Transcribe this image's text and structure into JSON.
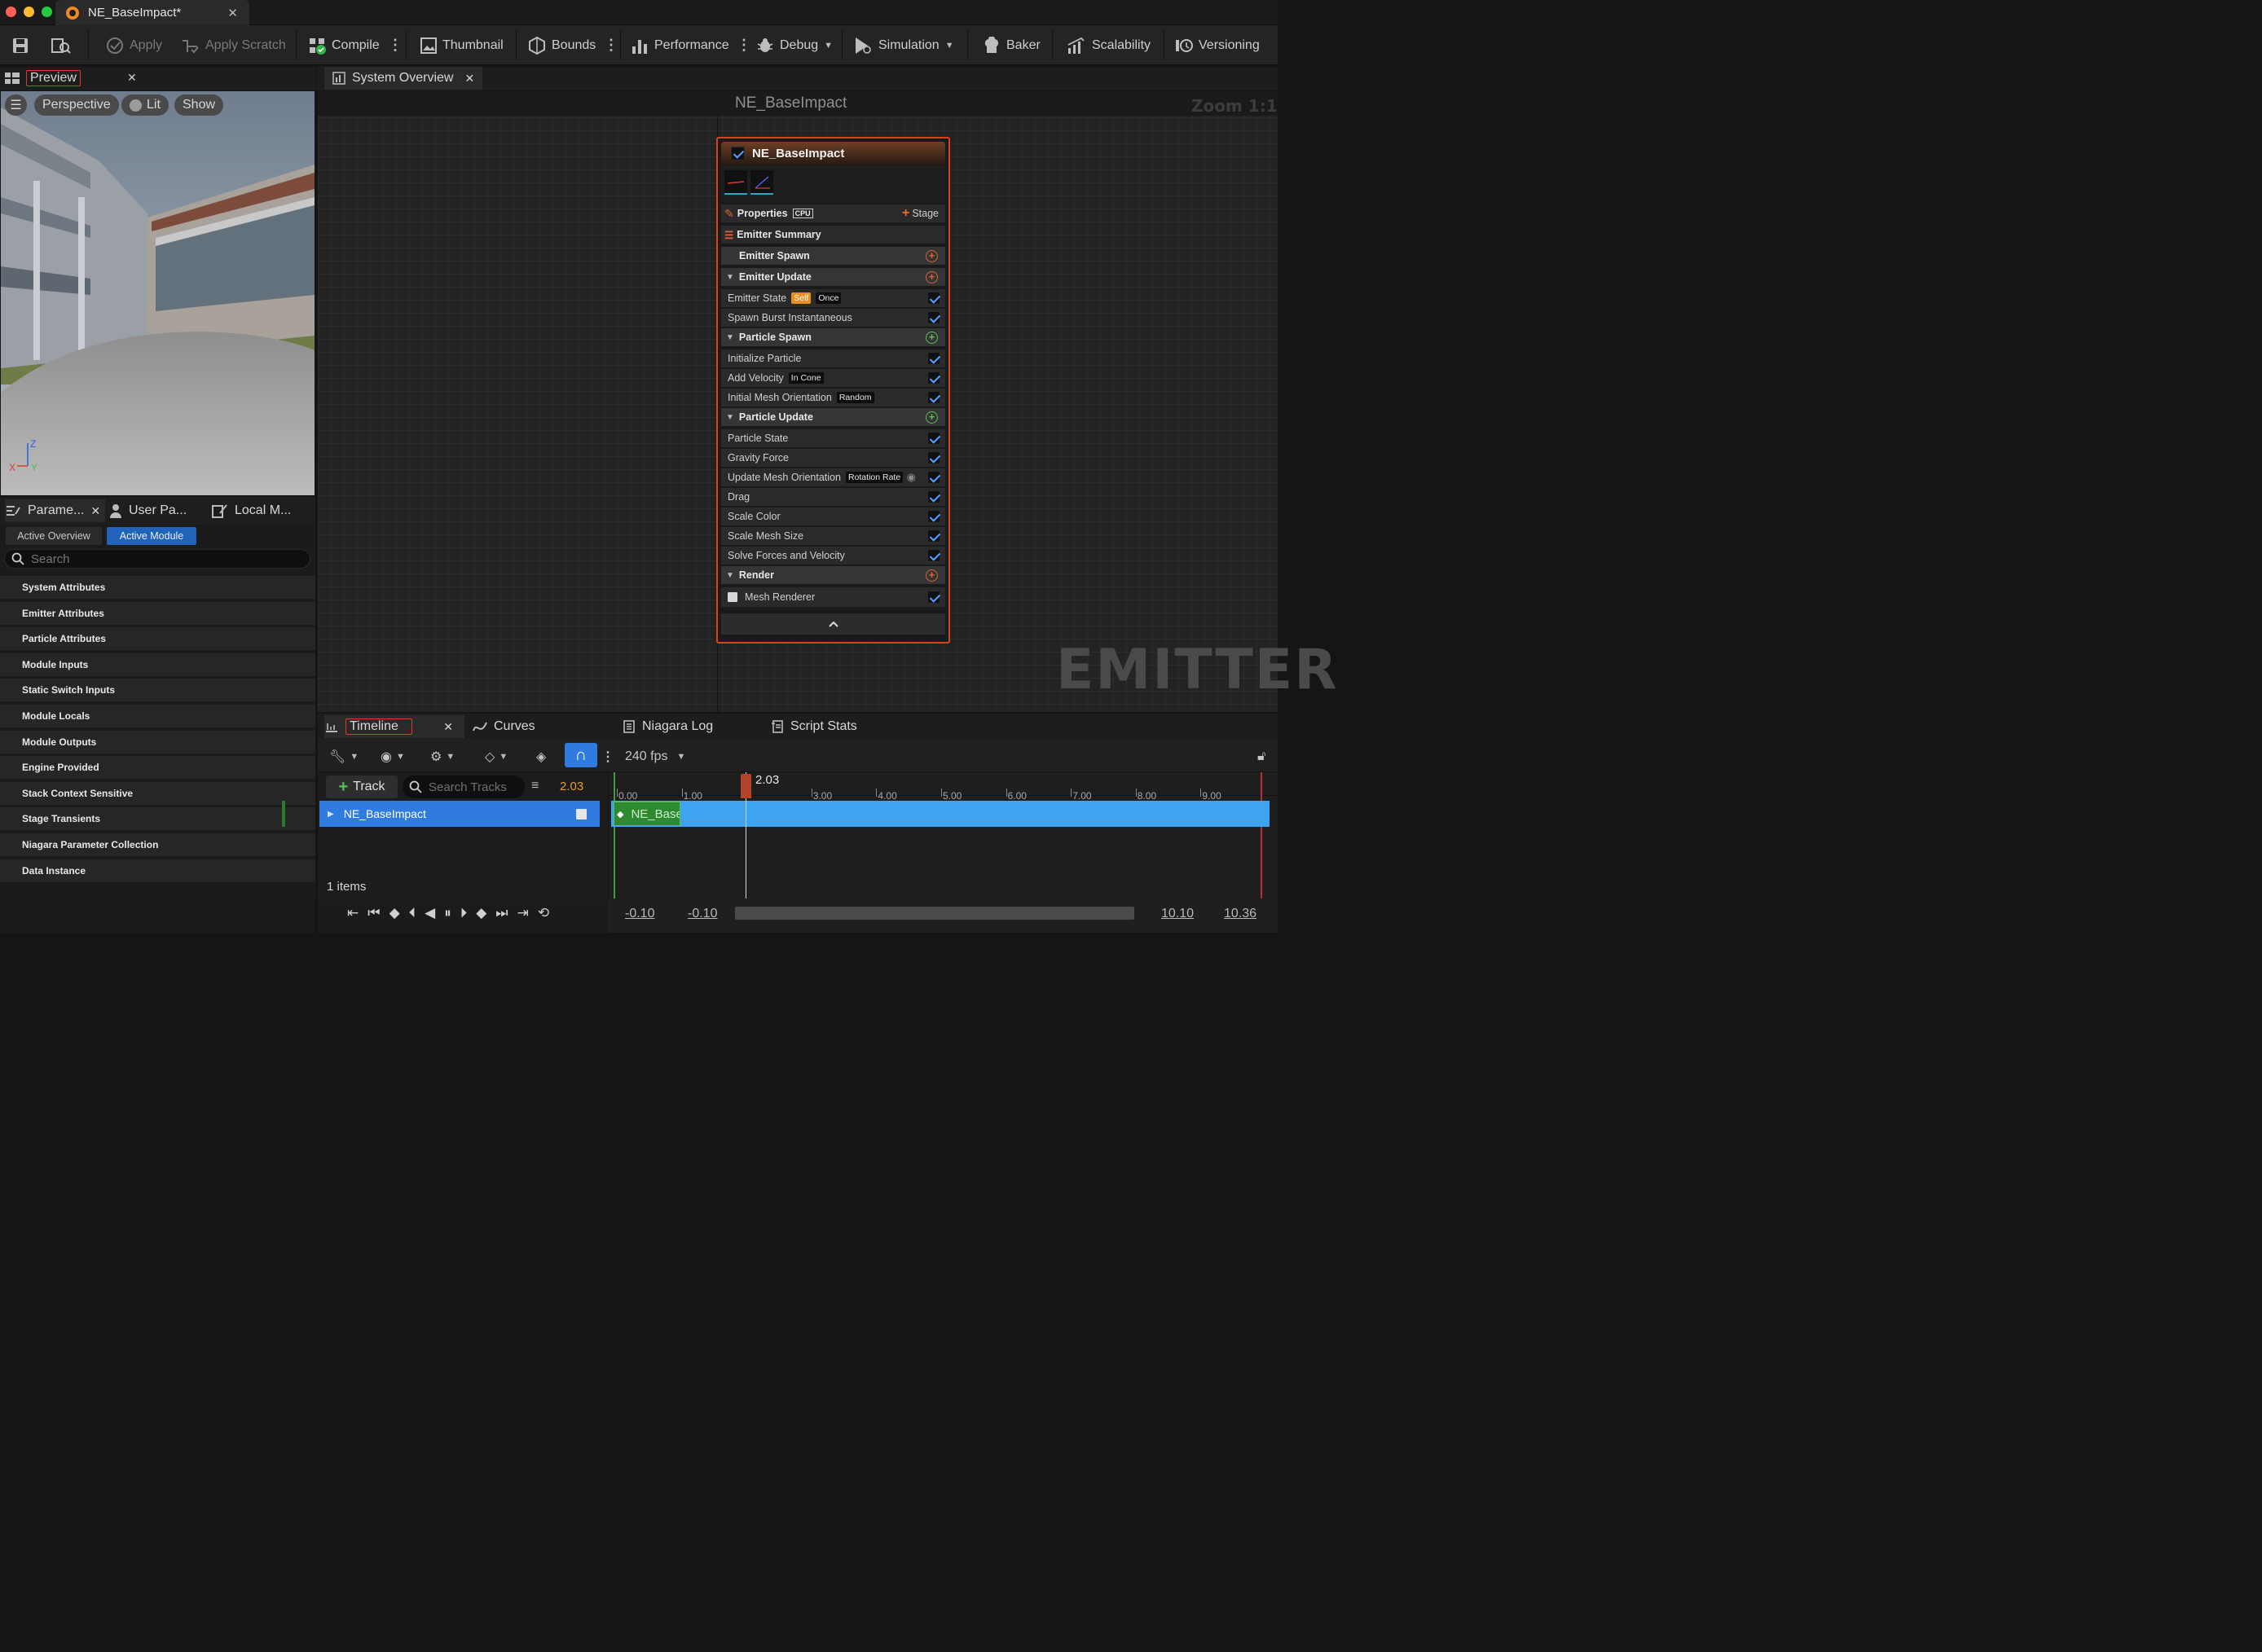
{
  "window": {
    "tab_title": "NE_BaseImpact*"
  },
  "toolbar": {
    "apply": "Apply",
    "apply_scratch": "Apply Scratch",
    "compile": "Compile",
    "thumbnail": "Thumbnail",
    "bounds": "Bounds",
    "performance": "Performance",
    "debug": "Debug",
    "simulation": "Simulation",
    "baker": "Baker",
    "scalability": "Scalability",
    "versioning": "Versioning"
  },
  "preview": {
    "tab": "Preview",
    "perspective": "Perspective",
    "lit": "Lit",
    "show": "Show",
    "axes": {
      "z": "Z",
      "x": "X",
      "y": "Y"
    }
  },
  "params": {
    "tabs": [
      "Parame...",
      "User Pa...",
      "Local M..."
    ],
    "active_overview": "Active Overview",
    "active_module": "Active Module",
    "search_placeholder": "Search",
    "rows": [
      "System Attributes",
      "Emitter Attributes",
      "Particle Attributes",
      "Module Inputs",
      "Static Switch Inputs",
      "Module Locals",
      "Module Outputs",
      "Engine Provided",
      "Stack Context Sensitive",
      "Stage Transients",
      "Niagara Parameter Collection",
      "Data Instance"
    ]
  },
  "graph": {
    "tab": "System Overview",
    "title": "NE_BaseImpact",
    "zoom": "Zoom 1:1",
    "watermark": "EMITTER"
  },
  "node": {
    "name": "NE_BaseImpact",
    "properties": "Properties",
    "cpu": "CPU",
    "stage": "Stage",
    "emitter_summary": "Emitter Summary",
    "emitter_spawn": "Emitter Spawn",
    "emitter_update": "Emitter Update",
    "emitter_state": "Emitter State",
    "self_badge": "Self",
    "once_badge": "Once",
    "spawn_burst": "Spawn Burst Instantaneous",
    "particle_spawn": "Particle Spawn",
    "initialize_particle": "Initialize Particle",
    "add_velocity": "Add Velocity",
    "in_cone": "In Cone",
    "initial_mesh_orientation": "Initial Mesh Orientation",
    "random": "Random",
    "particle_update": "Particle Update",
    "particle_state": "Particle State",
    "gravity_force": "Gravity Force",
    "update_mesh_orientation": "Update Mesh Orientation",
    "rotation_rate": "Rotation Rate",
    "drag": "Drag",
    "scale_color": "Scale Color",
    "scale_mesh_size": "Scale Mesh Size",
    "solve_forces": "Solve Forces and Velocity",
    "render": "Render",
    "mesh_renderer": "Mesh Renderer"
  },
  "timeline": {
    "tabs": {
      "timeline": "Timeline",
      "curves": "Curves",
      "niagara_log": "Niagara Log",
      "script_stats": "Script Stats"
    },
    "fps": "240 fps",
    "track_button": "Track",
    "search_placeholder": "Search Tracks",
    "current_time": "2.03",
    "playhead_label": "2.03",
    "ticks": [
      "0.00",
      "1.00",
      "3.00",
      "4.00",
      "5.00",
      "6.00",
      "7.00",
      "8.00",
      "9.00"
    ],
    "track_name": "NE_BaseImpact",
    "section_label": "NE_Basel",
    "items_count": "1 items",
    "range": {
      "start1": "-0.10",
      "start2": "-0.10",
      "end1": "10.10",
      "end2": "10.36"
    }
  },
  "colors": {
    "accent": "#e03a2a",
    "selection": "#2f7be0",
    "track_bar": "#3ea3f0",
    "check": "#5aa0ff"
  }
}
